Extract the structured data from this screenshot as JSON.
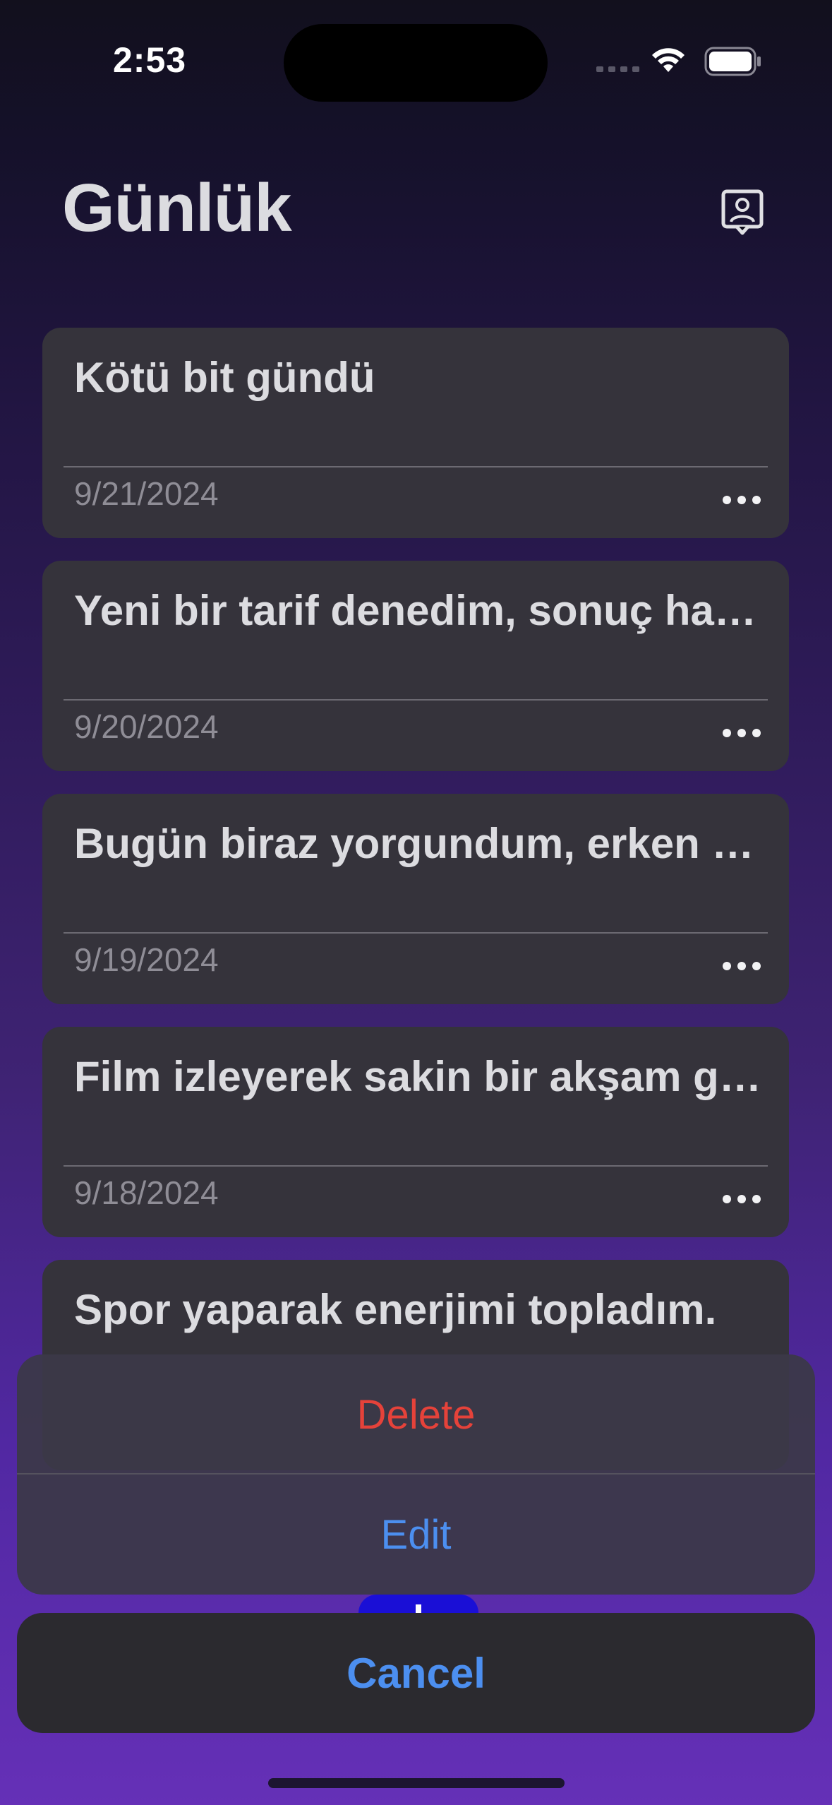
{
  "status_bar": {
    "time": "2:53"
  },
  "header": {
    "title": "Günlük",
    "profile_icon": "profile-card-icon"
  },
  "entries": [
    {
      "text": "Kötü bit gündü",
      "date": "9/21/2024"
    },
    {
      "text": "Yeni bir tarif denedim, sonuç harika oldu!",
      "date": "9/20/2024"
    },
    {
      "text": "Bugün biraz yorgundum, erken yattım.",
      "date": "9/19/2024"
    },
    {
      "text": "Film izleyerek sakin bir akşam geçirdim.",
      "date": "9/18/2024"
    },
    {
      "text": "Spor yaparak enerjimi topladım.",
      "date": ""
    }
  ],
  "action_sheet": {
    "delete_label": "Delete",
    "edit_label": "Edit",
    "cancel_label": "Cancel"
  },
  "colors": {
    "destructive": "#e5423a",
    "accent": "#4c8ff0",
    "card_bg": "#35333b",
    "fab": "#1a0fd6"
  }
}
